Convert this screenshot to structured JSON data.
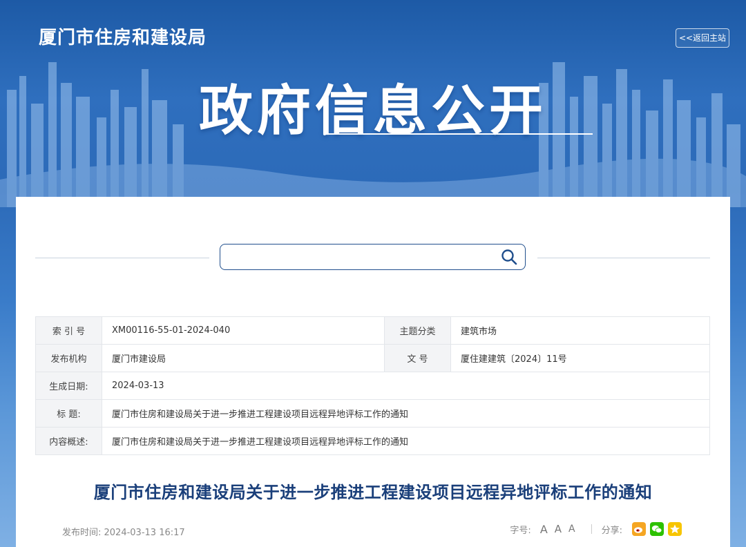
{
  "header": {
    "site_title": "厦门市住房和建设局",
    "back_label": "<<返回主站",
    "hero_title": "政府信息公开"
  },
  "search": {
    "placeholder": ""
  },
  "meta": {
    "index_label": "索 引 号",
    "index_value": "XM00116-55-01-2024-040",
    "topic_label": "主题分类",
    "topic_value": "建筑市场",
    "publisher_label": "发布机构",
    "publisher_value": "厦门市建设局",
    "doc_no_label": "文 号",
    "doc_no_value": "厦住建建筑〔2024〕11号",
    "date_label": "生成日期:",
    "date_value": "2024-03-13",
    "title_label": "标 题:",
    "title_value": "厦门市住房和建设局关于进一步推进工程建设项目远程异地评标工作的通知",
    "summary_label": "内容概述:",
    "summary_value": "厦门市住房和建设局关于进一步推进工程建设项目远程异地评标工作的通知"
  },
  "article": {
    "title": "厦门市住房和建设局关于进一步推进工程建设项目远程异地评标工作的通知",
    "publish_time": "发布时间: 2024-03-13 16:17"
  },
  "tools": {
    "font_label": "字号:",
    "font_large": "A",
    "font_medium": "A",
    "font_small": "A",
    "share_label": "分享:"
  },
  "colors": {
    "brand_blue": "#1a3f7a",
    "weibo": "#f5a623",
    "wechat": "#2dc100",
    "qzone": "#f7c500"
  }
}
